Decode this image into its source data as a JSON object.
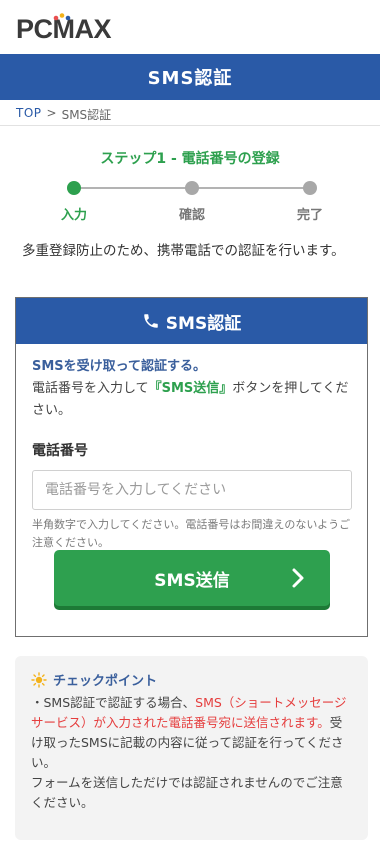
{
  "brand": {
    "name": "PCMAX",
    "primary": "#2a5aa7",
    "accent_green": "#2da04e",
    "alert_red": "#e53d3d"
  },
  "header": {
    "title": "SMS認証"
  },
  "breadcrumb": {
    "home": "TOP",
    "separator": ">",
    "current": "SMS認証"
  },
  "stepper": {
    "title": "ステップ1 - 電話番号の登録",
    "steps": [
      {
        "label": "入力",
        "state": "active"
      },
      {
        "label": "確認",
        "state": "inactive"
      },
      {
        "label": "完了",
        "state": "inactive"
      }
    ]
  },
  "intro": "多重登録防止のため、携帯電話での認証を行います。",
  "card": {
    "title": "SMS認証",
    "icon": "phone-icon",
    "lead_emphasis": "SMSを受け取って認証する。",
    "lead_before": "電話番号を入力して",
    "lead_highlight": "『SMS送信』",
    "lead_after": "ボタンを押してください。",
    "phone": {
      "label": "電話番号",
      "placeholder": "電話番号を入力してください",
      "value": "",
      "note": "半角数字で入力してください。電話番号はお間違えのないようご注意ください。"
    },
    "submit_label": "SMS送信"
  },
  "checkpoint": {
    "title": "チェックポイント",
    "icon": "sun-icon",
    "text_1": "・SMS認証で認証する場合、",
    "text_red": "SMS（ショートメッセージサービス）が入力された電話番号宛に送信されます。",
    "text_2": "受け取ったSMSに記載の内容に従って認証を行ってください。",
    "text_3": "フォームを送信しただけでは認証されませんのでご注意ください。"
  }
}
